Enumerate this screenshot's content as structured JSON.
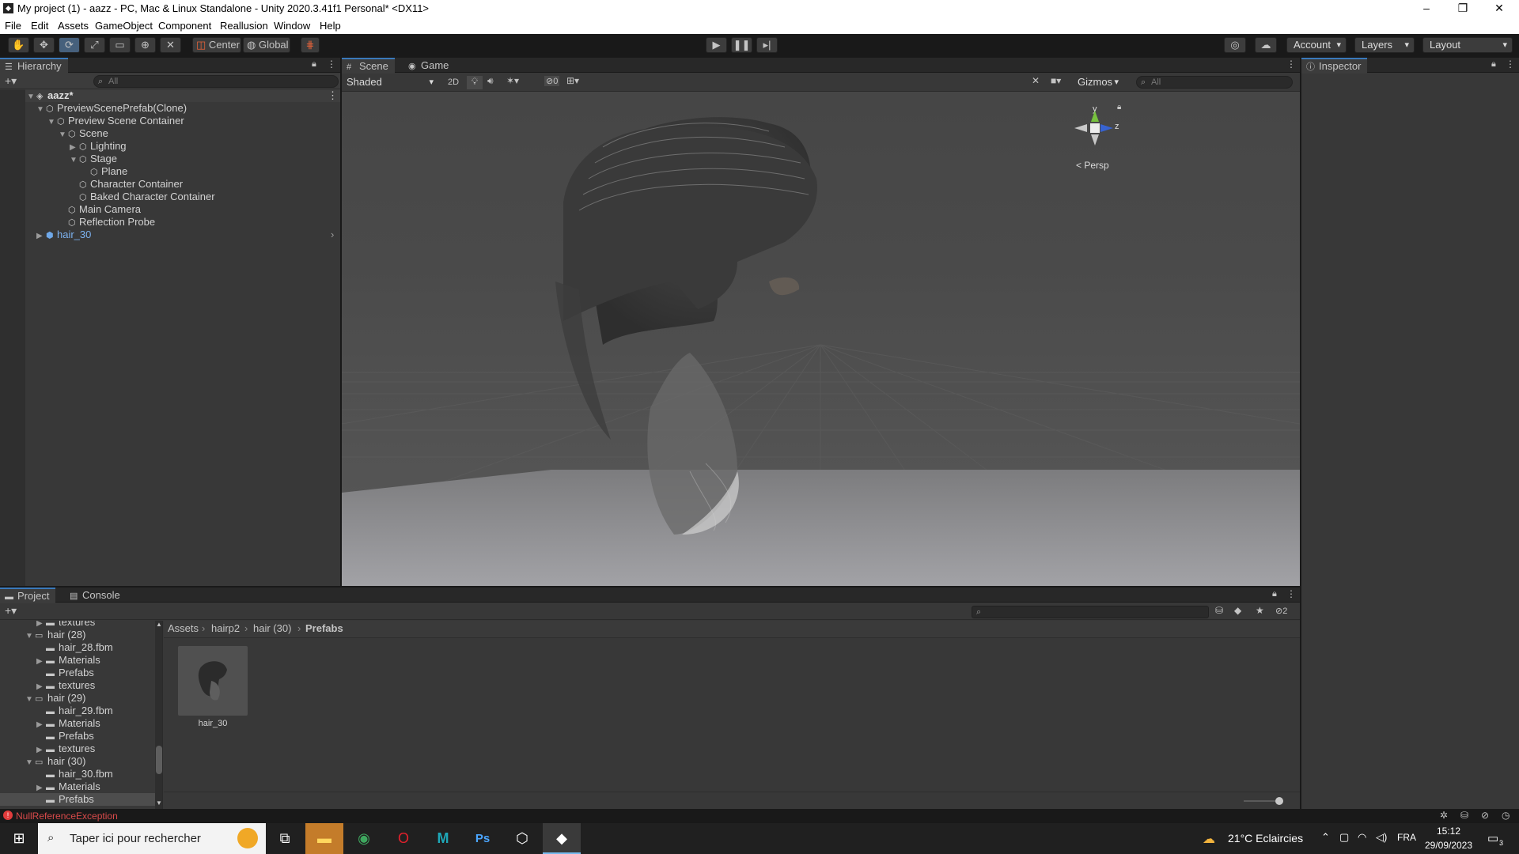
{
  "window": {
    "title": "My project (1) - aazz - PC, Mac & Linux Standalone - Unity 2020.3.41f1 Personal* <DX11>",
    "logo_icon": "unity-logo-icon",
    "minimize": "–",
    "restore": "❐",
    "close": "✕"
  },
  "menu": [
    "File",
    "Edit",
    "Assets",
    "GameObject",
    "Component",
    "Reallusion",
    "Window",
    "Help"
  ],
  "toolbar": {
    "tools": [
      "hand-icon",
      "move-icon",
      "rotate-icon",
      "scale-icon",
      "rect-icon",
      "transform-icon",
      "custom-tool-icon"
    ],
    "pivot": "Center",
    "space": "Global",
    "account": "Account",
    "layers": "Layers",
    "layout": "Layout"
  },
  "hierarchy": {
    "tab": "Hierarchy",
    "search_placeholder": "All",
    "items": [
      {
        "label": "aazz*",
        "indent": 0
      },
      {
        "label": "PreviewScenePrefab(Clone)",
        "indent": 1
      },
      {
        "label": "Preview Scene Container",
        "indent": 2
      },
      {
        "label": "Scene",
        "indent": 3
      },
      {
        "label": "Lighting",
        "indent": 4
      },
      {
        "label": "Stage",
        "indent": 4
      },
      {
        "label": "Plane",
        "indent": 5
      },
      {
        "label": "Character Container",
        "indent": 4
      },
      {
        "label": "Baked Character Container",
        "indent": 4
      },
      {
        "label": "Main Camera",
        "indent": 3
      },
      {
        "label": "Reflection Probe",
        "indent": 3
      },
      {
        "label": "hair_30",
        "indent": 1
      }
    ]
  },
  "scene": {
    "tab_scene": "Scene",
    "tab_game": "Game",
    "shading": "Shaded",
    "mode_2d": "2D",
    "hidden_count": "0",
    "gizmos": "Gizmos",
    "search_placeholder": "All",
    "axis_y": "y",
    "axis_z": "z",
    "projection": "< Persp"
  },
  "inspector": {
    "tab": "Inspector"
  },
  "project": {
    "tab_project": "Project",
    "tab_console": "Console",
    "hidden_count": "2",
    "tree": [
      {
        "label": "textures",
        "indent": 2
      },
      {
        "label": "hair (28)",
        "indent": 1
      },
      {
        "label": "hair_28.fbm",
        "indent": 2
      },
      {
        "label": "Materials",
        "indent": 2
      },
      {
        "label": "Prefabs",
        "indent": 2
      },
      {
        "label": "textures",
        "indent": 2
      },
      {
        "label": "hair (29)",
        "indent": 1
      },
      {
        "label": "hair_29.fbm",
        "indent": 2
      },
      {
        "label": "Materials",
        "indent": 2
      },
      {
        "label": "Prefabs",
        "indent": 2
      },
      {
        "label": "textures",
        "indent": 2
      },
      {
        "label": "hair (30)",
        "indent": 1
      },
      {
        "label": "hair_30.fbm",
        "indent": 2
      },
      {
        "label": "Materials",
        "indent": 2
      },
      {
        "label": "Prefabs",
        "indent": 2
      }
    ],
    "breadcrumb": [
      "Assets",
      "hairp2",
      "hair (30)",
      "Prefabs"
    ],
    "asset": {
      "label": "hair_30"
    }
  },
  "status": {
    "error": "NullReferenceException"
  },
  "taskbar": {
    "search_placeholder": "Taper ici pour rechercher",
    "weather": "21°C  Eclaircies",
    "lang": "FRA",
    "time": "15:12",
    "date": "29/09/2023",
    "notifications": "3"
  }
}
